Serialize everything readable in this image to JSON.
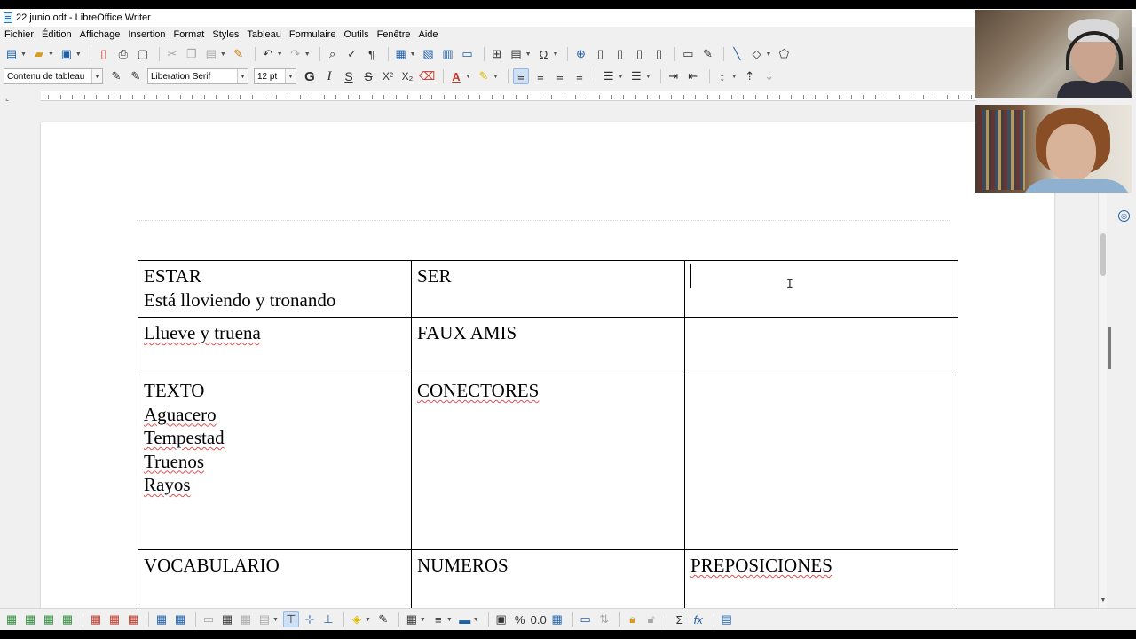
{
  "window": {
    "title": "22 junio.odt - LibreOffice Writer"
  },
  "menu": [
    "Fichier",
    "Édition",
    "Affichage",
    "Insertion",
    "Format",
    "Styles",
    "Tableau",
    "Formulaire",
    "Outils",
    "Fenêtre",
    "Aide"
  ],
  "formatting": {
    "paragraph_style": "Contenu de tableau",
    "font_name": "Liberation Serif",
    "font_size": "12 pt",
    "bold": "G",
    "italic": "I",
    "underline": "S",
    "strikethrough": "S",
    "superscript": "X²",
    "subscript": "X₂"
  },
  "document": {
    "table": {
      "rows": [
        [
          {
            "lines": [
              "ESTAR",
              "Está lloviendo y tronando"
            ]
          },
          {
            "lines": [
              "SER"
            ]
          },
          {
            "lines": [],
            "cursor": true
          }
        ],
        [
          {
            "lines": [
              "Llueve y truena"
            ]
          },
          {
            "lines": [
              "FAUX AMIS"
            ]
          },
          {
            "lines": []
          }
        ],
        [
          {
            "lines": [
              "TEXTO",
              "Aguacero",
              "Tempestad",
              "Truenos",
              "Rayos"
            ]
          },
          {
            "lines": [
              "CONECTORES"
            ]
          },
          {
            "lines": []
          }
        ],
        [
          {
            "lines": [
              "VOCABULARIO"
            ]
          },
          {
            "lines": [
              "NUMEROS"
            ]
          },
          {
            "lines": [
              "PREPOSICIONES"
            ]
          }
        ]
      ]
    }
  },
  "colors": {
    "accent": "#1f5fa8",
    "font_color": "#c0392b",
    "highlight": "#f5d90a",
    "spellcheck": "#e05050"
  }
}
